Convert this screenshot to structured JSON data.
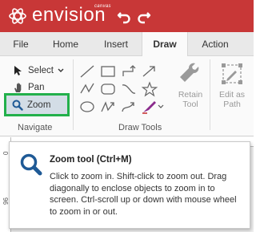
{
  "app": {
    "brand": "envision",
    "brand_super": "canvas"
  },
  "colors": {
    "titlebar": "#c83737",
    "zoom_highlight": "#22b04b",
    "tool_blue": "#1f5a96"
  },
  "menu": {
    "tabs": [
      "File",
      "Home",
      "Insert",
      "Draw",
      "Action"
    ],
    "active": "Draw"
  },
  "ribbon": {
    "navigate": {
      "select": "Select",
      "pan": "Pan",
      "zoom": "Zoom",
      "label": "Navigate"
    },
    "draw_tools": {
      "label": "Draw Tools",
      "icons": [
        "line-icon",
        "rectangle-icon",
        "connector-icon",
        "arrow-icon",
        "polyline-icon",
        "rounded-rectangle-icon",
        "curve-icon",
        "star-icon",
        "ellipse-icon",
        "freehand-arrow-icon",
        "curved-connector-icon",
        "pen-icon"
      ]
    },
    "retain_tool": {
      "line1": "Retain",
      "line2": "Tool"
    },
    "edit_as_path": {
      "line1": "Edit as",
      "line2": "Path"
    }
  },
  "ruler": {
    "left_numbers": [
      "0",
      "96"
    ]
  },
  "tooltip": {
    "title": "Zoom tool (Ctrl+M)",
    "body": "Click to zoom in. Shift-click to zoom out. Drag diagonally to enclose objects to zoom in to screen. Ctrl-scroll up or down with mouse wheel to zoom in or out."
  }
}
